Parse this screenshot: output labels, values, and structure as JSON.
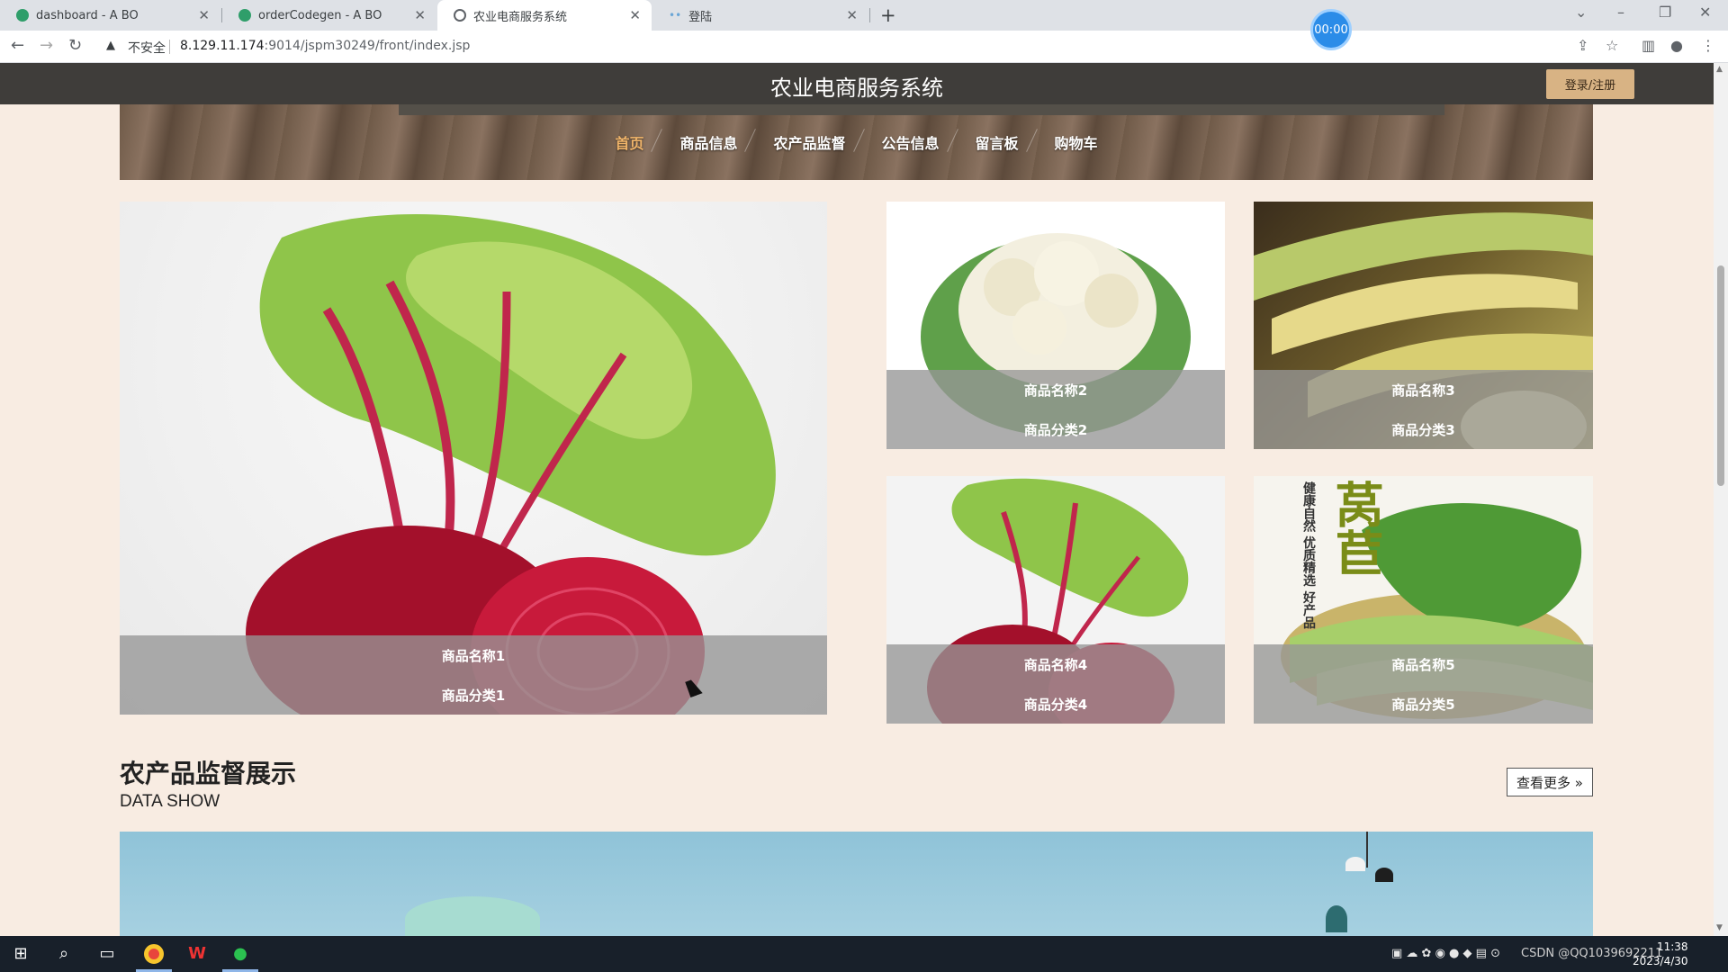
{
  "browser": {
    "tabs": [
      {
        "label": "dashboard - A BO",
        "favicon": "green-leaf-icon"
      },
      {
        "label": "orderCodegen - A BO",
        "favicon": "green-leaf-icon"
      },
      {
        "label": "农业电商服务系统",
        "favicon": "globe-icon"
      },
      {
        "label": "登陆",
        "favicon": "dots-icon"
      }
    ],
    "active_tab_index": 2,
    "recording_badge": "00:00",
    "address": {
      "security_label": "不安全",
      "url_host": "8.129.11.174",
      "url_rest": ":9014/jspm30249/front/index.jsp"
    }
  },
  "header": {
    "site_title": "农业电商服务系统",
    "login_button": "登录/注册"
  },
  "nav": {
    "items": [
      "首页",
      "商品信息",
      "农产品监督",
      "公告信息",
      "留言板",
      "购物车"
    ],
    "active_index": 0,
    "active_color": "#f1b56a"
  },
  "products": [
    {
      "name": "商品名称1",
      "category": "商品分类1",
      "image": "beetroot"
    },
    {
      "name": "商品名称2",
      "category": "商品分类2",
      "image": "cauliflower"
    },
    {
      "name": "商品名称3",
      "category": "商品分类3",
      "image": "corn"
    },
    {
      "name": "商品名称4",
      "category": "商品分类4",
      "image": "beetroot"
    },
    {
      "name": "商品名称5",
      "category": "商品分类5",
      "image": "lettuce-stem",
      "image_text": "健康自然 优质精选 好产品",
      "image_big_text": "莴苣"
    }
  ],
  "section": {
    "title": "农产品监督展示",
    "subtitle": "DATA SHOW",
    "more_button": "查看更多 »"
  },
  "taskbar": {
    "tray_text": "CSDN @QQ1039692211",
    "time": "11:38",
    "date": "2023/4/30"
  },
  "colors": {
    "page_bg": "#f8ece2",
    "topbar_bg": "#3f3d3a",
    "login_btn_bg": "#d8b384",
    "caption_overlay": "#969696"
  }
}
